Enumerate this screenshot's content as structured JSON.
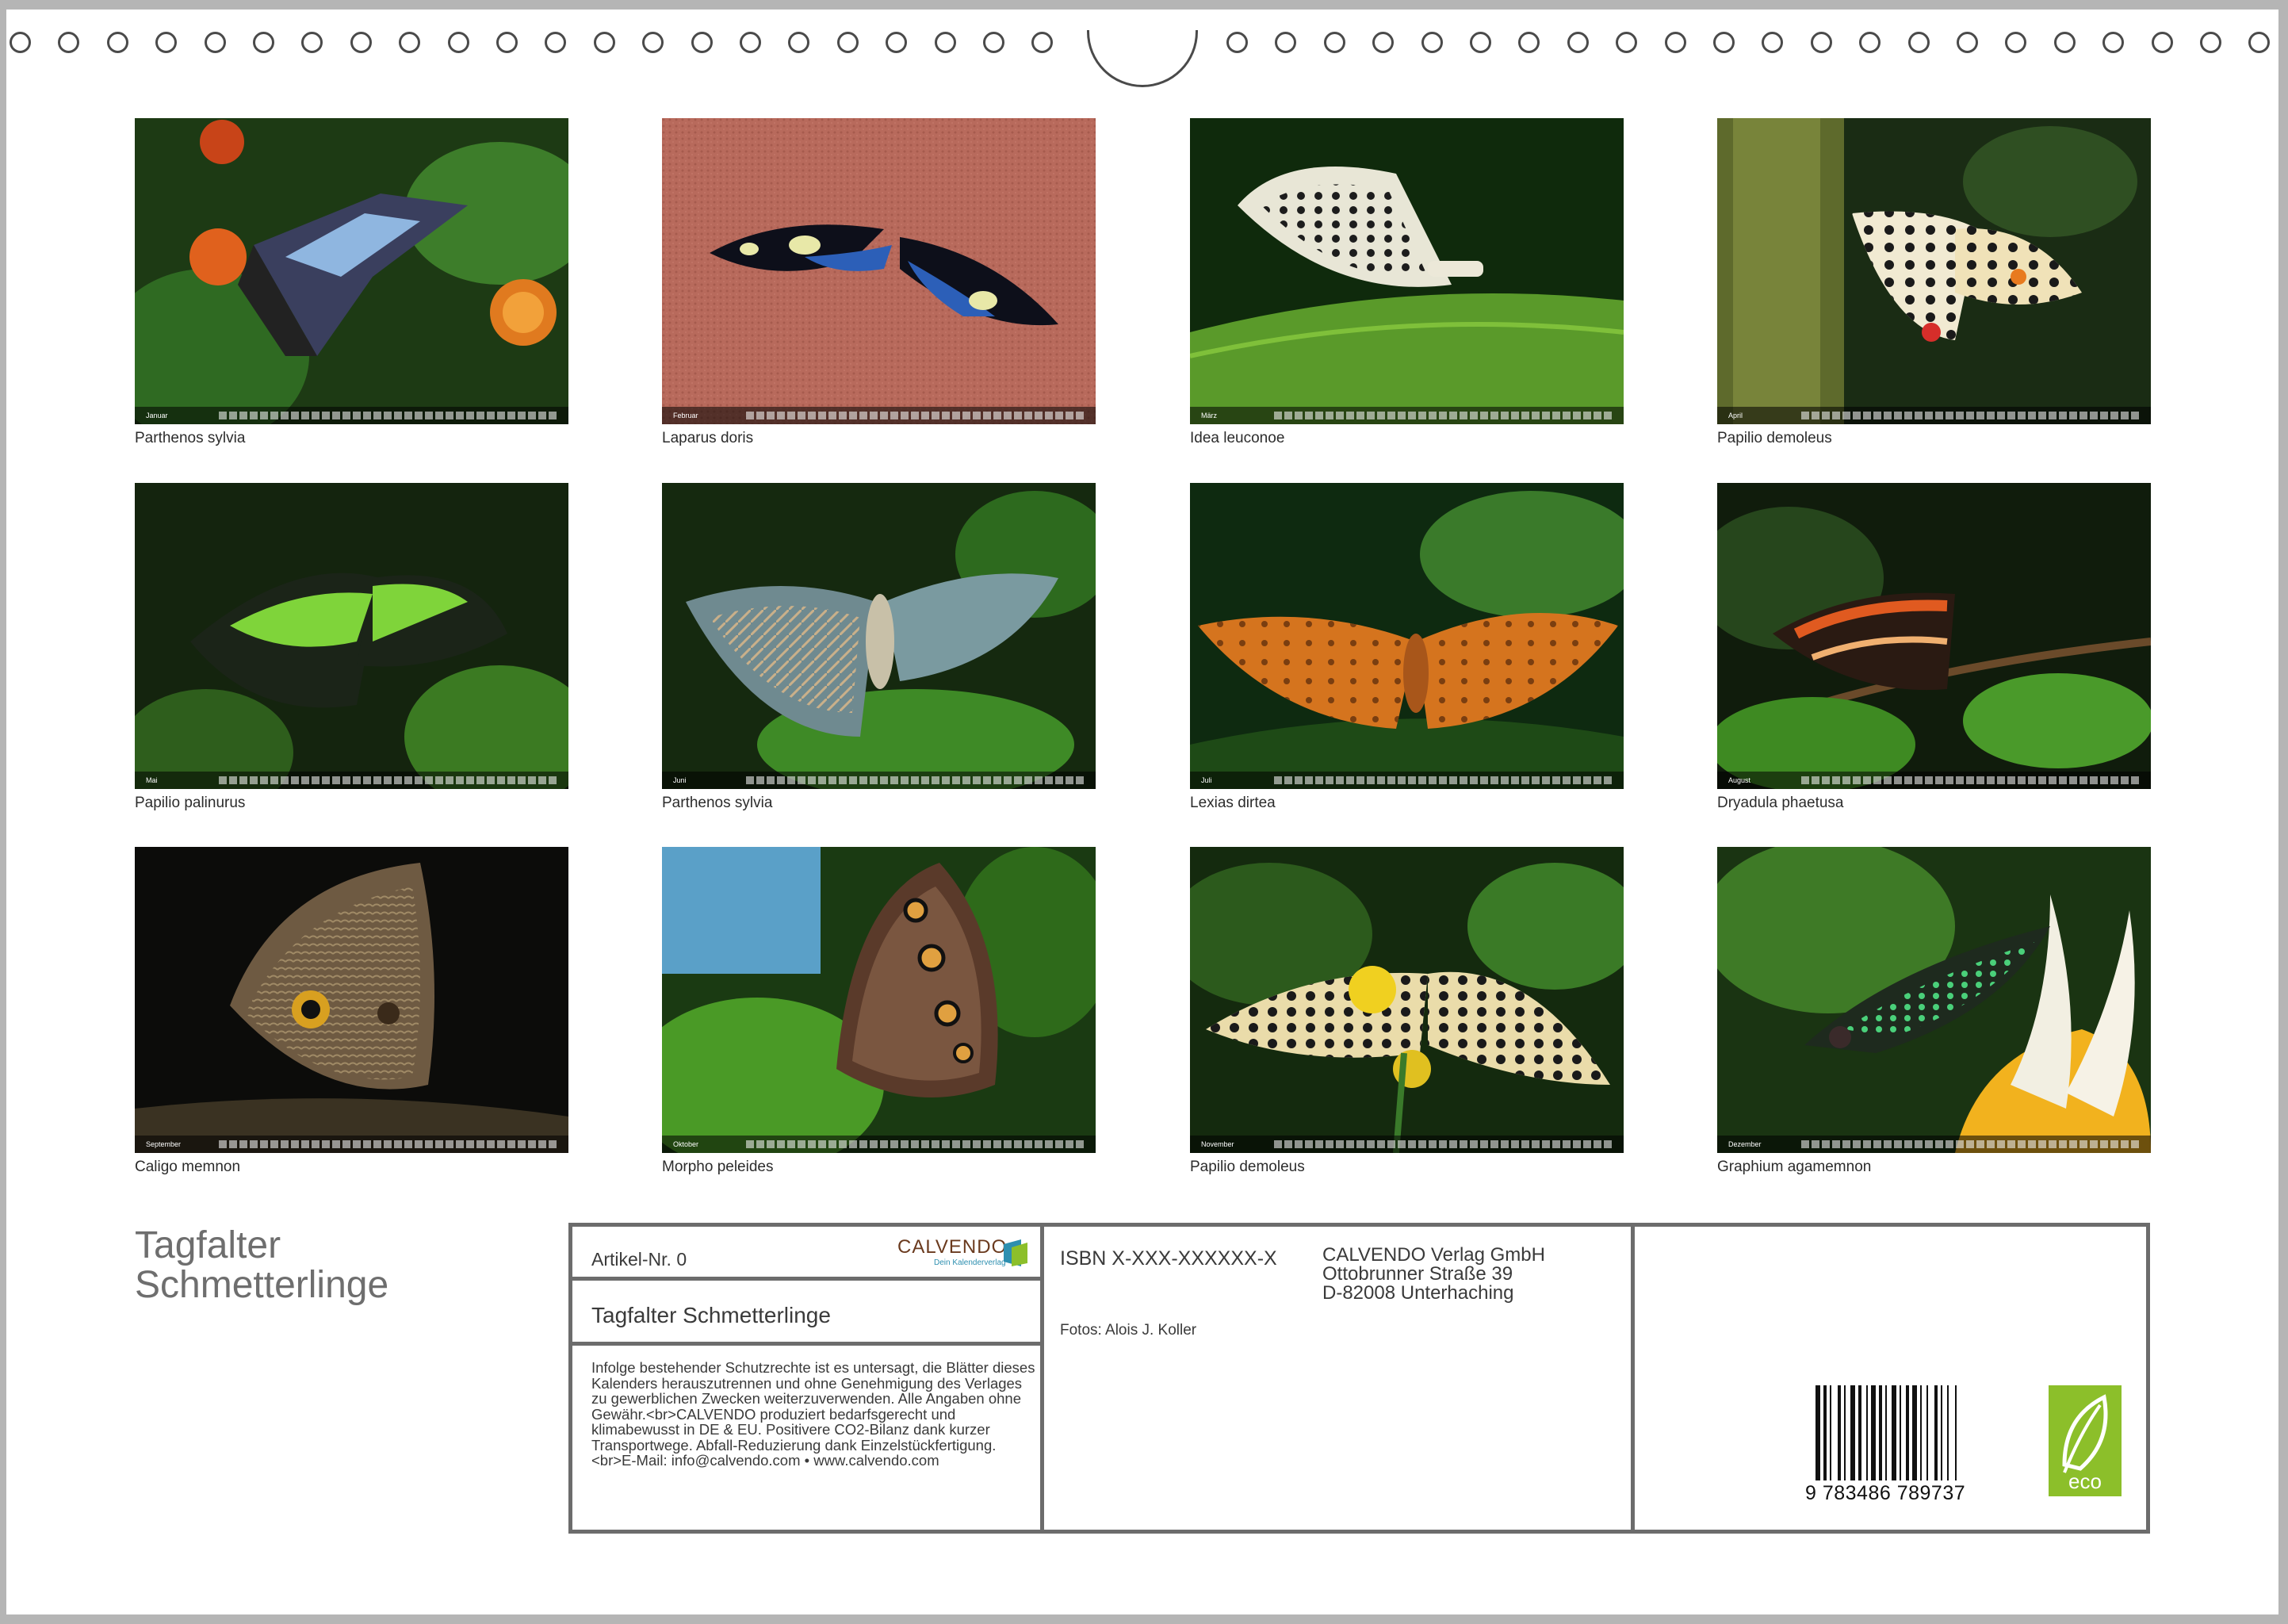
{
  "photos": [
    {
      "month": "Januar",
      "caption": "Parthenos sylvia"
    },
    {
      "month": "Februar",
      "caption": "Laparus doris"
    },
    {
      "month": "März",
      "caption": "Idea leuconoe"
    },
    {
      "month": "April",
      "caption": "Papilio demoleus"
    },
    {
      "month": "Mai",
      "caption": "Papilio palinurus"
    },
    {
      "month": "Juni",
      "caption": "Parthenos sylvia"
    },
    {
      "month": "Juli",
      "caption": "Lexias dirtea"
    },
    {
      "month": "August",
      "caption": "Dryadula phaetusa"
    },
    {
      "month": "September",
      "caption": "Caligo memnon"
    },
    {
      "month": "Oktober",
      "caption": "Morpho peleides"
    },
    {
      "month": "November",
      "caption": "Papilio demoleus"
    },
    {
      "month": "Dezember",
      "caption": "Graphium agamemnon"
    }
  ],
  "title": {
    "line1": "Tagfalter",
    "line2": "Schmetterlinge"
  },
  "info": {
    "artikel": "Artikel-Nr. 0",
    "logo_brand": "CALVENDO",
    "logo_tagline": "Dein Kalenderverlag",
    "subtitle": "Tagfalter Schmetterlinge",
    "legal": "Infolge bestehender Schutzrechte ist es untersagt, die Blätter dieses Kalenders herauszutrennen und ohne Genehmigung des Verlages zu gewerblichen Zwecken weiterzuverwenden. Alle Angaben ohne Gewähr.<br>CALVENDO produziert bedarfsgerecht und klimabewusst in DE & EU. Positivere CO2-Bilanz dank kurzer Transportwege. Abfall-Reduzierung dank Einzelstückfertigung.<br>E-Mail: info@calvendo.com • www.calvendo.com",
    "isbn": "ISBN X-XXX-XXXXXX-X",
    "fotos": "Fotos: Alois J. Koller",
    "publisher_name": "CALVENDO Verlag GmbH",
    "publisher_street": "Ottobrunner Straße 39",
    "publisher_city": "D-82008 Unterhaching",
    "barcode_number": "9 783486 789737",
    "eco_label": "eco"
  },
  "colors": {
    "border": "#6c6c6c",
    "title": "#6e6e6e",
    "eco_green": "#8cbf2a"
  }
}
